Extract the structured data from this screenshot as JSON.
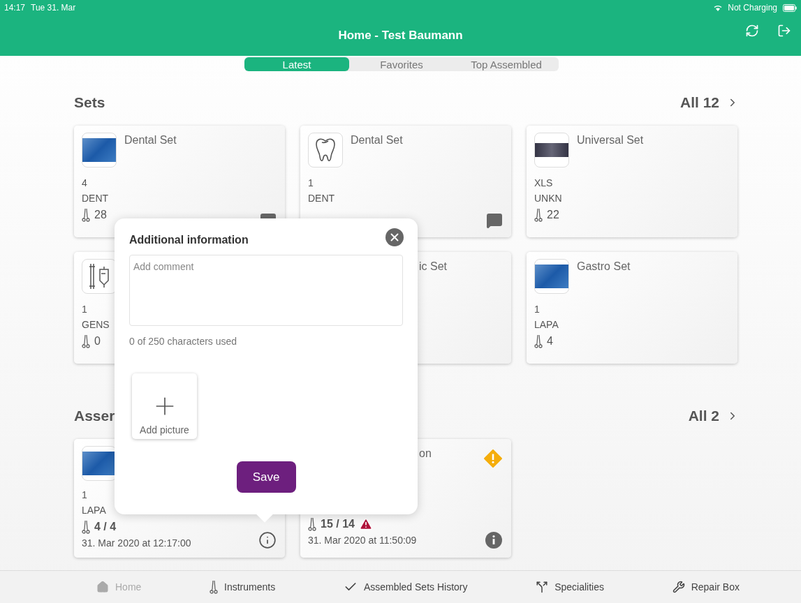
{
  "status_bar": {
    "time": "14:17",
    "date": "Tue 31. Mar",
    "charging": "Not Charging"
  },
  "header": {
    "title": "Home - Test Baumann"
  },
  "tabs": [
    {
      "label": "Latest",
      "selected": true
    },
    {
      "label": "Favorites",
      "selected": false
    },
    {
      "label": "Top Assembled",
      "selected": false
    }
  ],
  "sets": {
    "title": "Sets",
    "all": "All 12",
    "cards": [
      {
        "kind": "photo",
        "title": "Dental Set",
        "code": "4",
        "specialty": "DENT",
        "instruments": "28",
        "comment": true
      },
      {
        "kind": "tooth",
        "title": "Dental Set",
        "code": "1",
        "specialty": "DENT",
        "comment": true
      },
      {
        "kind": "tray",
        "title": "Universal Set",
        "code": "XLS",
        "specialty": "UNKN",
        "instruments": "22",
        "comment": false
      },
      {
        "kind": "drip",
        "code": "1",
        "specialty": "GENS",
        "instruments": "0",
        "comment": false
      },
      {
        "kind": "hidden",
        "title": "ic Set",
        "comment": false
      },
      {
        "kind": "photo",
        "title": "Gastro Set",
        "code": "1",
        "specialty": "LAPA",
        "instruments": "4",
        "comment": false
      }
    ]
  },
  "assembled": {
    "title": "Asser",
    "all": "All 2",
    "cards": [
      {
        "kind": "photo",
        "code": "1",
        "specialty": "LAPA",
        "instruments": "4 / 4",
        "alert": false,
        "warning": false,
        "date": "31. Mar 2020 at 12:17:00",
        "info_filled": false
      },
      {
        "kind": "hidden",
        "title": "on",
        "instruments": "15 / 14",
        "alert": true,
        "warning": true,
        "date": "31. Mar 2020 at 11:50:09",
        "info_filled": true
      }
    ]
  },
  "popover": {
    "title": "Additional information",
    "placeholder": "Add comment",
    "counter": "0 of 250 characters used",
    "add_picture": "Add picture",
    "save": "Save"
  },
  "nav": [
    {
      "kind": "home",
      "label": "Home",
      "selected": true
    },
    {
      "kind": "instruments",
      "label": "Instruments",
      "selected": false
    },
    {
      "kind": "history",
      "label": "Assembled Sets History",
      "selected": false
    },
    {
      "kind": "specialities",
      "label": "Specialities",
      "selected": false
    },
    {
      "kind": "repair",
      "label": "Repair Box",
      "selected": false
    }
  ]
}
